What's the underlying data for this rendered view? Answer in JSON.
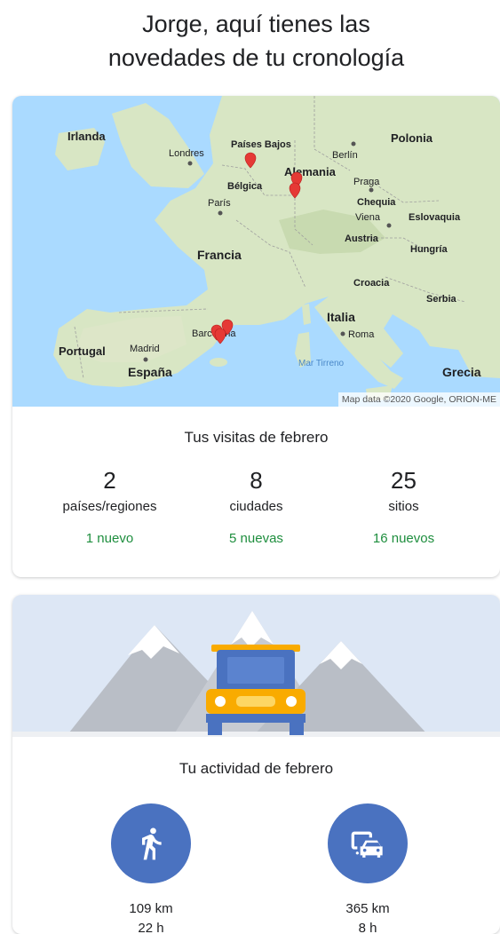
{
  "headline": {
    "line1": "Jorge, aquí tienes las",
    "line2": "novedades de tu cronología"
  },
  "map": {
    "countries": {
      "irlanda": "Irlanda",
      "paises_bajos": "Países Bajos",
      "polonia": "Polonia",
      "alemania": "Alemania",
      "belgica": "Bélgica",
      "chequia": "Chequia",
      "eslovaquia": "Eslovaquia",
      "austria": "Austria",
      "hungria": "Hungría",
      "francia": "Francia",
      "croacia": "Croacia",
      "serbia": "Serbia",
      "italia": "Italia",
      "portugal": "Portugal",
      "espana": "España",
      "grecia": "Grecia"
    },
    "cities": {
      "londres": "Londres",
      "berlin": "Berlín",
      "praga": "Praga",
      "paris": "París",
      "viena": "Viena",
      "barcelona": "Barcelona",
      "roma": "Roma",
      "madrid": "Madrid"
    },
    "seas": {
      "tirreno": "Mar Tirreno"
    },
    "attribution": "Map data ©2020 Google, ORION-ME",
    "colors": {
      "sea": "#aadaff",
      "land": "#d8e6c4",
      "pin": "#e53935"
    }
  },
  "visits": {
    "title": "Tus visitas de febrero",
    "stats": [
      {
        "number": "2",
        "label": "países/regiones",
        "new": "1 nuevo"
      },
      {
        "number": "8",
        "label": "ciudades",
        "new": "5 nuevas"
      },
      {
        "number": "25",
        "label": "sitios",
        "new": "16 nuevos"
      }
    ]
  },
  "activity": {
    "title": "Tu actividad de febrero",
    "items": [
      {
        "icon": "walking-icon",
        "distance": "109 km",
        "duration": "22 h"
      },
      {
        "icon": "car-icon",
        "distance": "365 km",
        "duration": "8 h"
      }
    ]
  }
}
